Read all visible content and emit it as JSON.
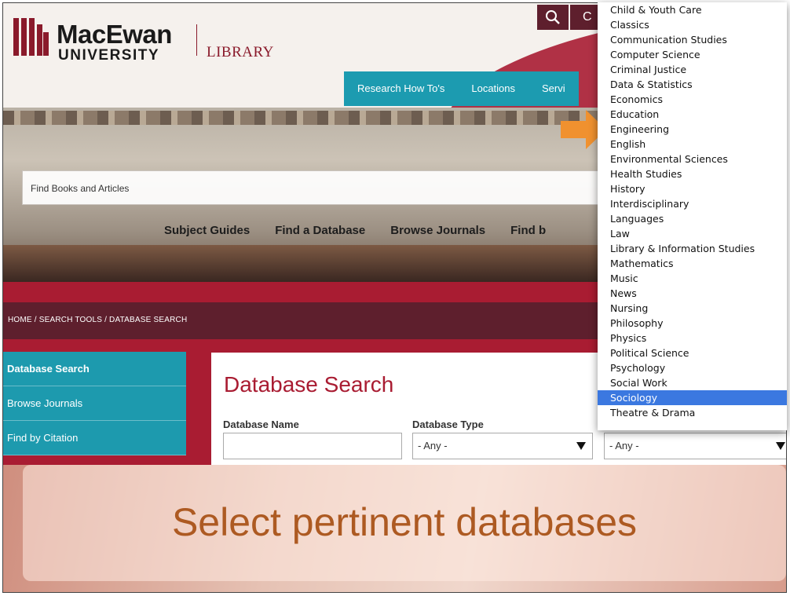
{
  "header": {
    "logo_name": "MacEwan",
    "logo_sub": "UNIVERSITY",
    "library": "LIBRARY",
    "search_icon": "search-icon",
    "util_label": "C",
    "nav": [
      "Research How To's",
      "Locations",
      "Servi"
    ]
  },
  "hero": {
    "find_placeholder": "Find Books and Articles",
    "tabs": [
      "Subject Guides",
      "Find a Database",
      "Browse Journals",
      "Find b"
    ]
  },
  "breadcrumb": "HOME  /  SEARCH TOOLS  /  DATABASE SEARCH",
  "sidebar": {
    "items": [
      "Database Search",
      "Browse Journals",
      "Find by Citation"
    ]
  },
  "main": {
    "title": "Database Search",
    "name_label": "Database Name",
    "type_label": "Database Type",
    "type_value": "- Any -",
    "subject_value": "- Any -"
  },
  "dropdown": {
    "options": [
      "Child & Youth Care",
      "Classics",
      "Communication Studies",
      "Computer Science",
      "Criminal Justice",
      "Data & Statistics",
      "Economics",
      "Education",
      "Engineering",
      "English",
      "Environmental Sciences",
      "Health Studies",
      "History",
      "Interdisciplinary",
      "Languages",
      "Law",
      "Library & Information Studies",
      "Mathematics",
      "Music",
      "News",
      "Nursing",
      "Philosophy",
      "Physics",
      "Political Science",
      "Psychology",
      "Social Work",
      "Sociology",
      "Theatre & Drama"
    ],
    "selected": "Sociology"
  },
  "overlay": {
    "text": "Select pertinent databases"
  },
  "colors": {
    "brand_red": "#a91c32",
    "teal": "#1c9bb0",
    "dark_maroon": "#5e1f2d",
    "highlight_blue": "#3b78e0",
    "arrow_orange": "#f0912f"
  }
}
